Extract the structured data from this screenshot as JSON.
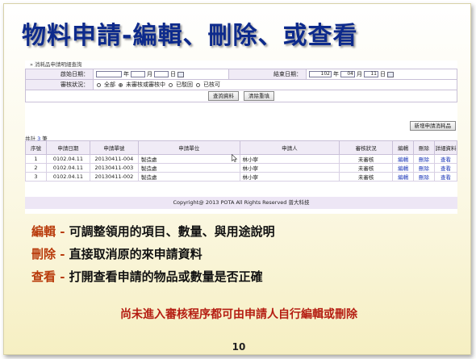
{
  "slide": {
    "title": "物料申請-編輯、刪除、或查看",
    "page_number": "10"
  },
  "app": {
    "breadcrumb": "» 消耗品申請明細查詢",
    "filters": {
      "start_date_label": "啟始日期：",
      "start_date_suffixes": [
        "年",
        "月",
        "日"
      ],
      "end_date_label": "結束日期：",
      "end_year": "102",
      "end_month": "04",
      "end_day": "11",
      "end_date_suffixes": [
        "年",
        "月",
        "日"
      ],
      "status_label": "審核狀況：",
      "status_options": [
        "全部",
        "未審核或審核中",
        "已駁回",
        "已核可"
      ],
      "status_selected": "未審核或審核中",
      "search_button": "查詢資料",
      "clear_button": "清除重填"
    },
    "count_prefix": "共計",
    "count": "3",
    "count_suffix": "筆",
    "add_button": "新增申請消耗品",
    "table": {
      "headers": [
        "序號",
        "申請日期",
        "申請單號",
        "申請單位",
        "申請人",
        "審核狀況",
        "編輯",
        "刪除",
        "詳細資料"
      ],
      "rows": [
        [
          "1",
          "0102.04.11",
          "20130411-004",
          "製造處",
          "林小寧",
          "未審核",
          "編輯",
          "刪除",
          "查看"
        ],
        [
          "2",
          "0102.04.11",
          "20130411-003",
          "製造處",
          "林小寧",
          "未審核",
          "編輯",
          "刪除",
          "查看"
        ],
        [
          "3",
          "0102.04.11",
          "20130411-002",
          "製造處",
          "林小寧",
          "未審核",
          "編輯",
          "刪除",
          "查看"
        ]
      ]
    },
    "footer": "Copyright@ 2013 POTA All Rights Reserved   普大科技"
  },
  "bullets": [
    {
      "keyword": "編輯 -",
      "text": " 可調整領用的項目、數量、與用途說明"
    },
    {
      "keyword": "刪除 -",
      "text": " 直接取消原的來申請資料"
    },
    {
      "keyword": "查看 -",
      "text": " 打開查看申請的物品或數量是否正確"
    }
  ],
  "note": "尚未進入審核程序都可由申請人自行編輯或刪除",
  "colors": {
    "title": "#0d2a8c",
    "keyword": "#b83a0a",
    "note": "#b51d12",
    "link": "#1a35b8",
    "header_bg": "#f0ebf6"
  }
}
